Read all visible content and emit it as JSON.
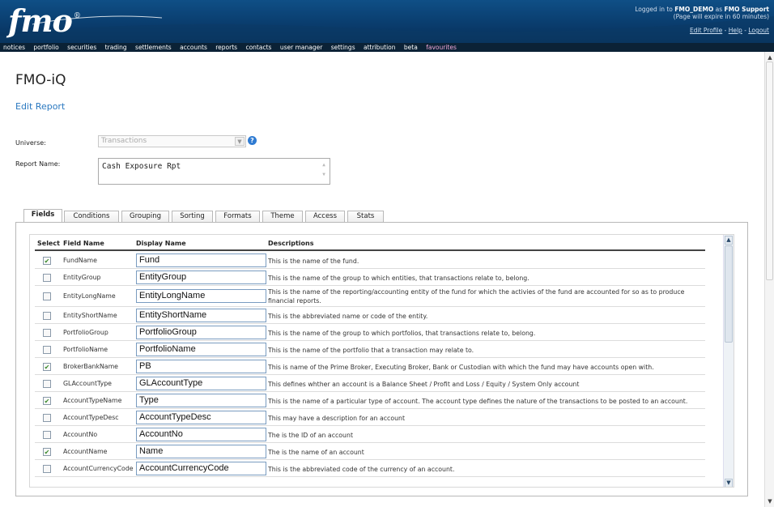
{
  "header": {
    "logo_text": "fmo",
    "logo_mark": "®",
    "login_prefix": "Logged in to",
    "login_account": "FMO_DEMO",
    "login_as": "as",
    "login_user": "FMO Support",
    "expiry_note": "(Page will expire in 60 minutes)",
    "links": [
      "Edit Profile",
      "Help",
      "Logout"
    ]
  },
  "nav": {
    "items": [
      "notices",
      "portfolio",
      "securities",
      "trading",
      "settlements",
      "accounts",
      "reports",
      "contacts",
      "user manager",
      "settings",
      "attribution",
      "beta",
      "favourites"
    ]
  },
  "page": {
    "title": "FMO-iQ",
    "subtitle": "Edit Report"
  },
  "form": {
    "universe_label": "Universe:",
    "universe_value": "Transactions",
    "report_name_label": "Report Name:",
    "report_name_value": "Cash Exposure Rpt"
  },
  "tabs": [
    "Fields",
    "Conditions",
    "Grouping",
    "Sorting",
    "Formats",
    "Theme",
    "Access",
    "Stats"
  ],
  "active_tab": "Fields",
  "grid": {
    "columns": [
      "Select",
      "Field Name",
      "Display Name",
      "Descriptions"
    ],
    "rows": [
      {
        "checked": true,
        "field": "FundName",
        "display": "Fund",
        "desc": "This is the name of the fund."
      },
      {
        "checked": false,
        "field": "EntityGroup",
        "display": "EntityGroup",
        "desc": "This is the name of the group to which entities, that transactions relate to, belong."
      },
      {
        "checked": false,
        "field": "EntityLongName",
        "display": "EntityLongName",
        "desc": "This is the name of the reporting/accounting entity of the fund for which the activies of the fund are accounted for so as to produce financial reports."
      },
      {
        "checked": false,
        "field": "EntityShortName",
        "display": "EntityShortName",
        "desc": "This is the abbreviated name or code of the entity."
      },
      {
        "checked": false,
        "field": "PortfolioGroup",
        "display": "PortfolioGroup",
        "desc": "This is the name of the group to which portfolios, that transactions relate to, belong."
      },
      {
        "checked": false,
        "field": "PortfolioName",
        "display": "PortfolioName",
        "desc": "This is the name of the portfolio that a transaction may relate to."
      },
      {
        "checked": true,
        "field": "BrokerBankName",
        "display": "PB",
        "desc": "This is name of the Prime Broker, Executing Broker, Bank or Custodian with which the fund may have accounts open with."
      },
      {
        "checked": false,
        "field": "GLAccountType",
        "display": "GLAccountType",
        "desc": "This defines whther an account is a Balance Sheet / Profit and Loss / Equity / System Only account"
      },
      {
        "checked": true,
        "field": "AccountTypeName",
        "display": "Type",
        "desc": "This is the name of a particular type of account. The account type defines the nature of the transactions to be posted to an account."
      },
      {
        "checked": false,
        "field": "AccountTypeDesc",
        "display": "AccountTypeDesc",
        "desc": "This may have a description for an account"
      },
      {
        "checked": false,
        "field": "AccountNo",
        "display": "AccountNo",
        "desc": "The is the ID of an account"
      },
      {
        "checked": true,
        "field": "AccountName",
        "display": "Name",
        "desc": "The is the name of an account"
      },
      {
        "checked": false,
        "field": "AccountCurrencyCode",
        "display": "AccountCurrencyCode",
        "desc": "This is the abbreviated code of the currency of an account."
      }
    ]
  }
}
